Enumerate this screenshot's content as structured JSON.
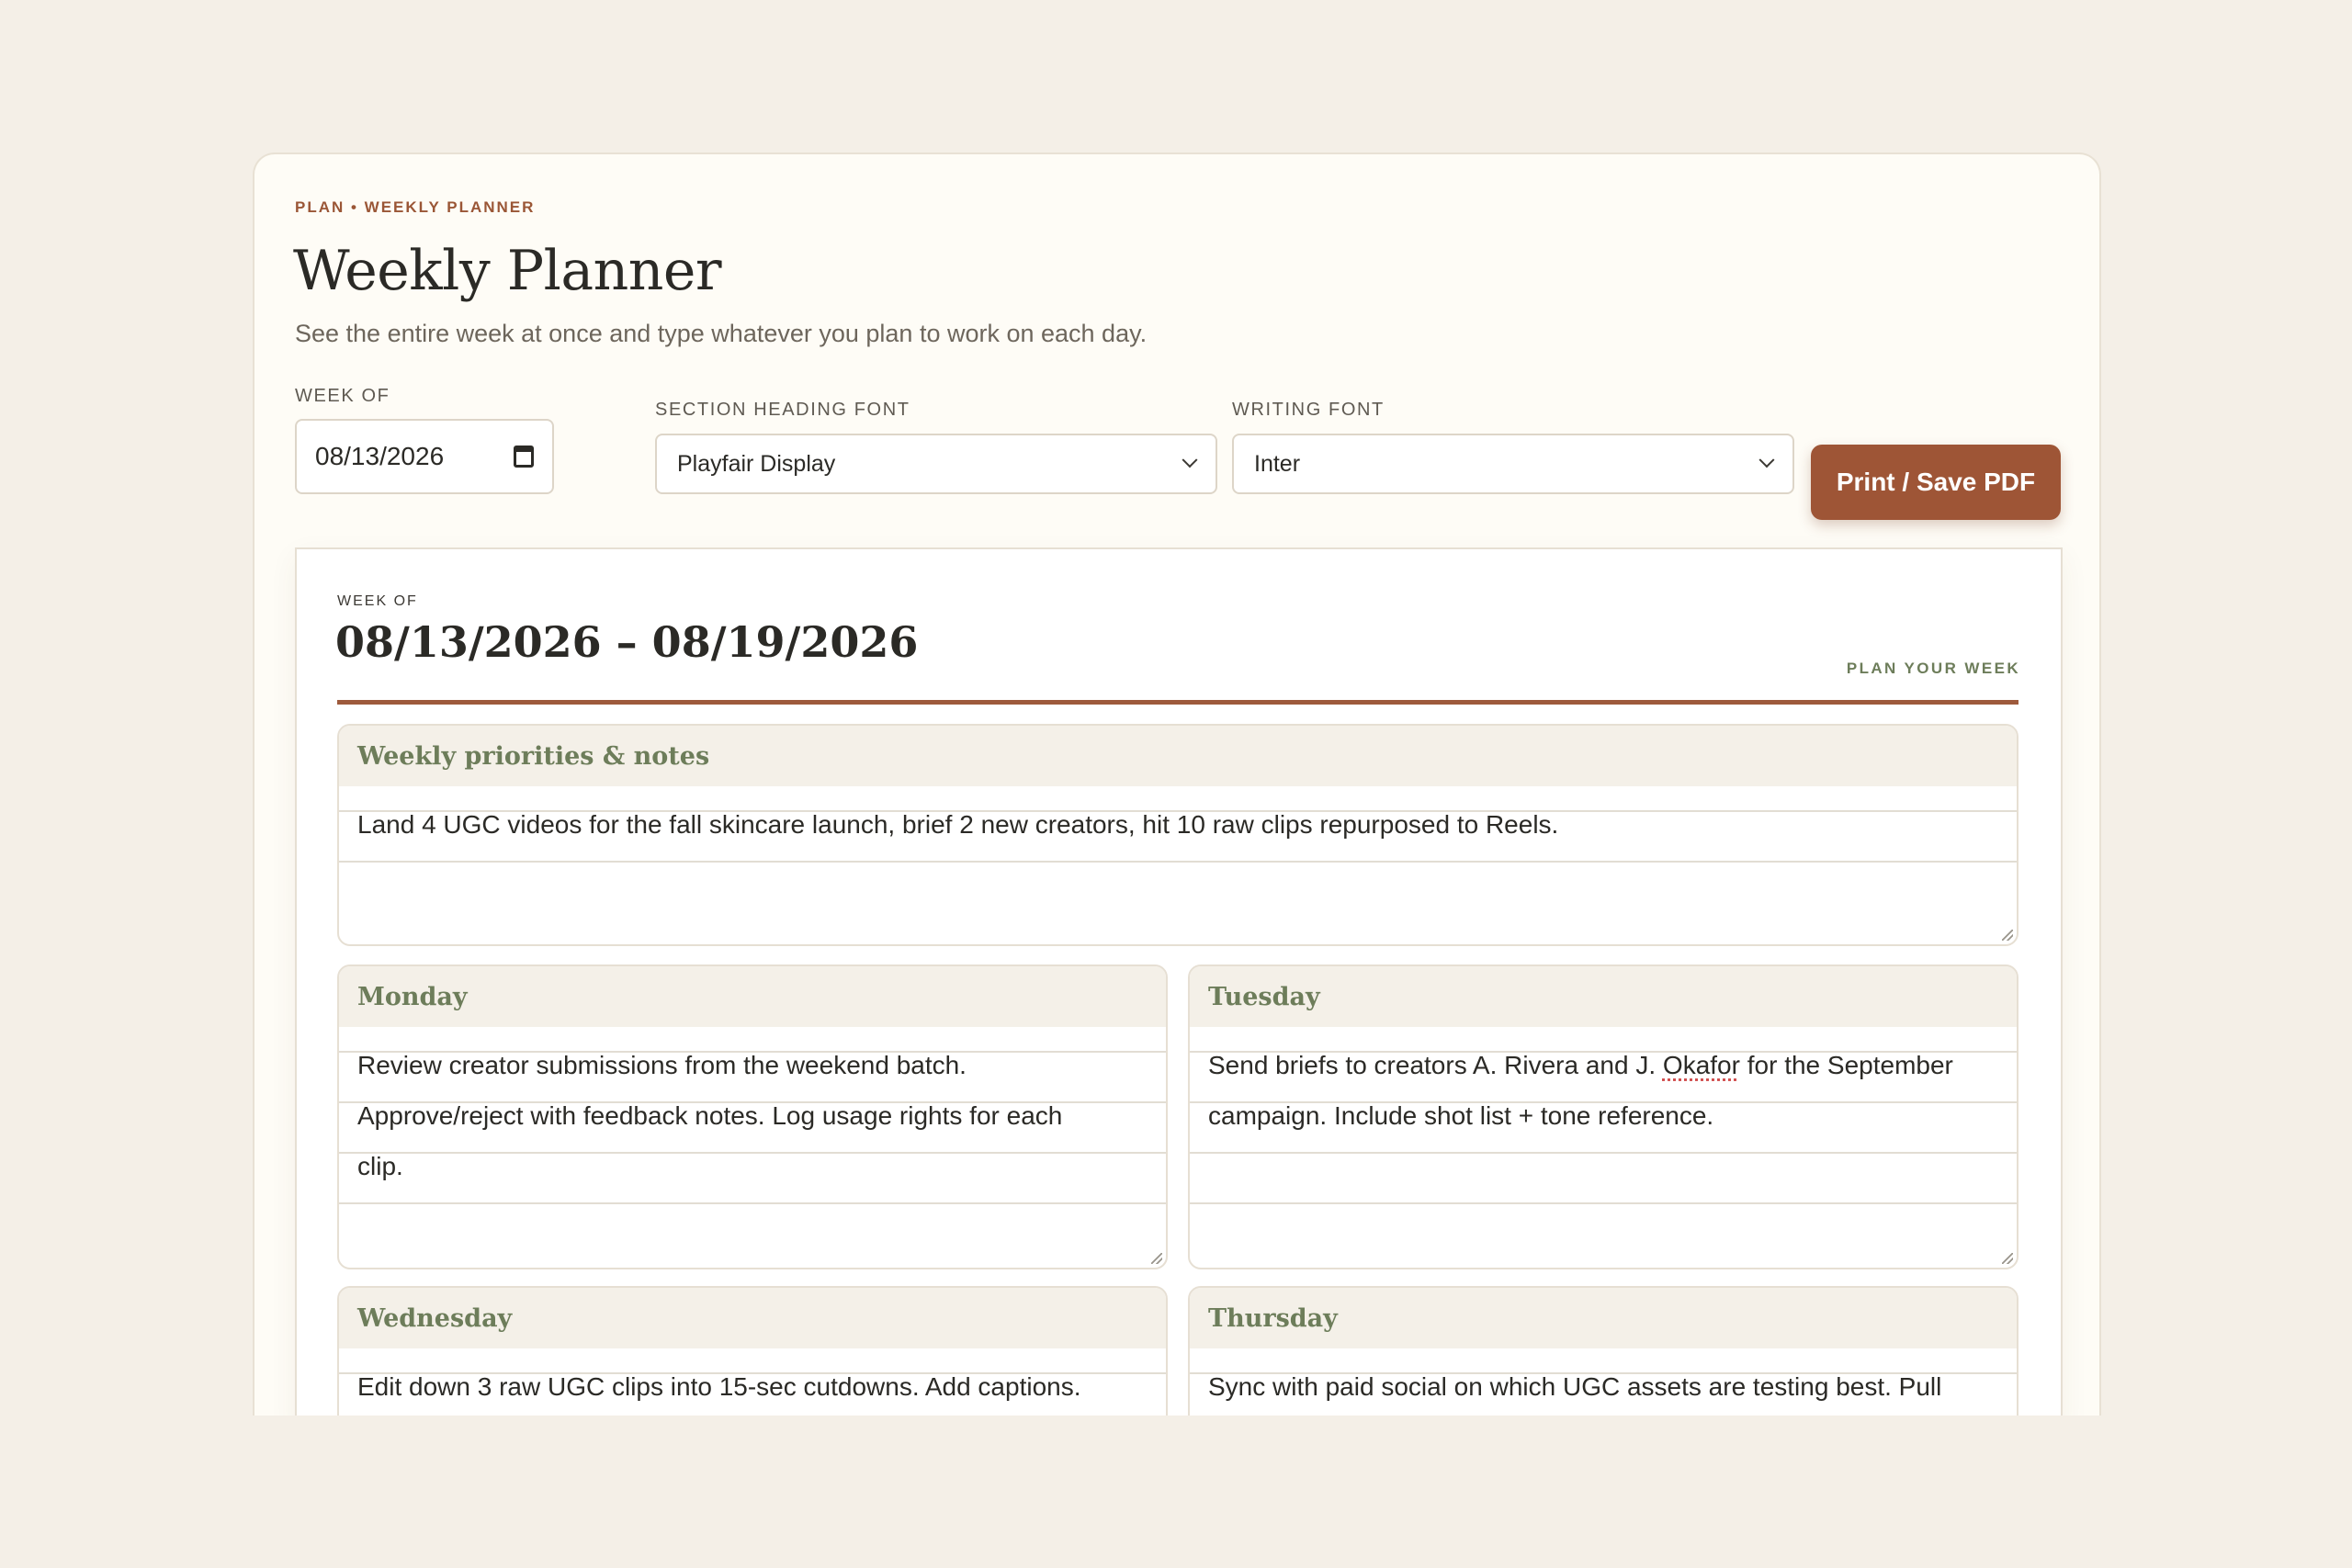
{
  "header": {
    "eyebrow": "PLAN • WEEKLY PLANNER",
    "title": "Weekly Planner",
    "subtitle": "See the entire week at once and type whatever you plan to work on each day."
  },
  "controls": {
    "week_of_label": "WEEK OF",
    "week_of_value": "08/13/2026",
    "heading_font_label": "SECTION HEADING FONT",
    "heading_font_value": "Playfair Display",
    "writing_font_label": "WRITING FONT",
    "writing_font_value": "Inter",
    "print_label": "Print / Save PDF"
  },
  "sheet": {
    "eyebrow": "WEEK OF",
    "range": "08/13/2026 – 08/19/2026",
    "tag": "PLAN YOUR WEEK"
  },
  "sections": {
    "priorities": {
      "heading": "Weekly priorities & notes",
      "lines": [
        "Land 4 UGC videos for the fall skincare launch, brief 2 new creators, hit 10 raw clips repurposed to Reels.",
        ""
      ]
    },
    "monday": {
      "heading": "Monday",
      "lines": [
        "Review creator submissions from the weekend batch.",
        "Approve/reject with feedback notes. Log usage rights for each",
        "clip.",
        ""
      ]
    },
    "tuesday": {
      "heading": "Tuesday",
      "line1_a": "Send briefs to creators A. Rivera and J. ",
      "line1_b": "Okafor",
      "line1_c": " for the September",
      "lines": [
        "campaign. Include shot list + tone reference.",
        "",
        ""
      ]
    },
    "wednesday": {
      "heading": "Wednesday",
      "lines": [
        "Edit down 3 raw UGC clips into 15-sec cutdowns. Add captions."
      ]
    },
    "thursday": {
      "heading": "Thursday",
      "lines": [
        "Sync with paid social on which UGC assets are testing best. Pull"
      ]
    }
  },
  "icons": {
    "date": "calendar-icon",
    "select": "chevron-down-icon"
  },
  "colors": {
    "page_bg": "#f4efe7",
    "accent": "#9e5536",
    "section_heading": "#6d7d5a"
  }
}
